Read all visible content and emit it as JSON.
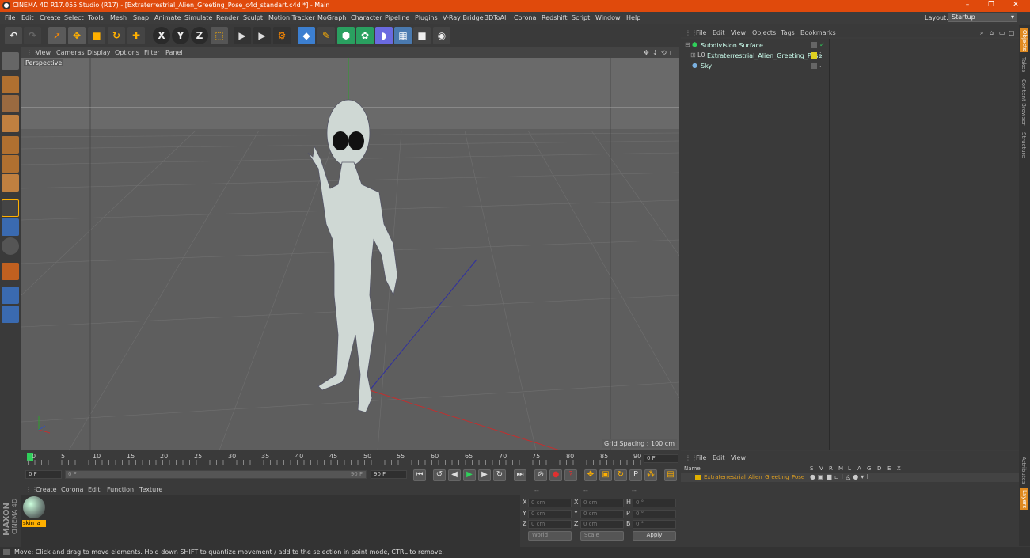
{
  "title": "CINEMA 4D R17.055 Studio (R17) - [Extraterrestrial_Alien_Greeting_Pose_c4d_standart.c4d *] - Main",
  "window_controls": {
    "minimize": "–",
    "restore": "❐",
    "close": "✕"
  },
  "menu": [
    "File",
    "Edit",
    "Create",
    "Select",
    "Tools",
    "Mesh",
    "Snap",
    "Animate",
    "Simulate",
    "Render",
    "Sculpt",
    "Motion Tracker",
    "MoGraph",
    "Character",
    "Pipeline",
    "Plugins",
    "V-Ray Bridge",
    "3DToAll",
    "Corona",
    "Redshift",
    "Script",
    "Window",
    "Help"
  ],
  "layout": {
    "label": "Layout:",
    "value": "Startup"
  },
  "toolbar": {
    "x_axis": "X",
    "y_axis": "Y",
    "z_axis": "Z"
  },
  "viewport": {
    "menu": [
      "View",
      "Cameras",
      "Display",
      "Options",
      "Filter",
      "Panel"
    ],
    "camera_label": "Perspective",
    "grid_spacing": "Grid Spacing : 100 cm"
  },
  "timeline": {
    "ticks": [
      "0",
      "5",
      "10",
      "15",
      "20",
      "25",
      "30",
      "35",
      "40",
      "45",
      "50",
      "55",
      "60",
      "65",
      "70",
      "75",
      "80",
      "85",
      "90"
    ],
    "current_frame": "0 F",
    "start_field": "0 F",
    "slider_start": "0 F",
    "slider_end": "90 F",
    "end_field": "90 F"
  },
  "material_menu": [
    "Create",
    "Corona",
    "Edit",
    "Function",
    "Texture"
  ],
  "material": {
    "name": "skin_a"
  },
  "coords": {
    "header": [
      "--",
      "--",
      "--"
    ],
    "rows": [
      {
        "a": "X",
        "av": "0 cm",
        "b": "X",
        "bv": "0 cm",
        "c": "H",
        "cv": "0 °"
      },
      {
        "a": "Y",
        "av": "0 cm",
        "b": "Y",
        "bv": "0 cm",
        "c": "P",
        "cv": "0 °"
      },
      {
        "a": "Z",
        "av": "0 cm",
        "b": "Z",
        "bv": "0 cm",
        "c": "B",
        "cv": "0 °"
      }
    ],
    "world": "World",
    "scale": "Scale",
    "apply": "Apply"
  },
  "objects_menu": [
    "File",
    "Edit",
    "View",
    "Objects",
    "Tags",
    "Bookmarks"
  ],
  "objects": [
    {
      "name": "Subdivision Surface"
    },
    {
      "name": "Extraterrestrial_Alien_Greeting_Pose"
    },
    {
      "name": "Sky"
    }
  ],
  "layers_menu": [
    "File",
    "Edit",
    "View"
  ],
  "layers_header": {
    "name": "Name",
    "cols": [
      "S",
      "V",
      "R",
      "M",
      "L",
      "A",
      "G",
      "D",
      "E",
      "X"
    ]
  },
  "layers_row": "Extraterrestrial_Alien_Greeting_Pose",
  "side_tabs": [
    "Objects",
    "Takes",
    "Content Browser",
    "Structure",
    "Attributes",
    "Layers"
  ],
  "brand": {
    "maxon": "MAXON",
    "c4d": "CINEMA 4D"
  },
  "status": "Move: Click and drag to move elements. Hold down SHIFT to quantize movement / add to the selection in point mode, CTRL to remove."
}
